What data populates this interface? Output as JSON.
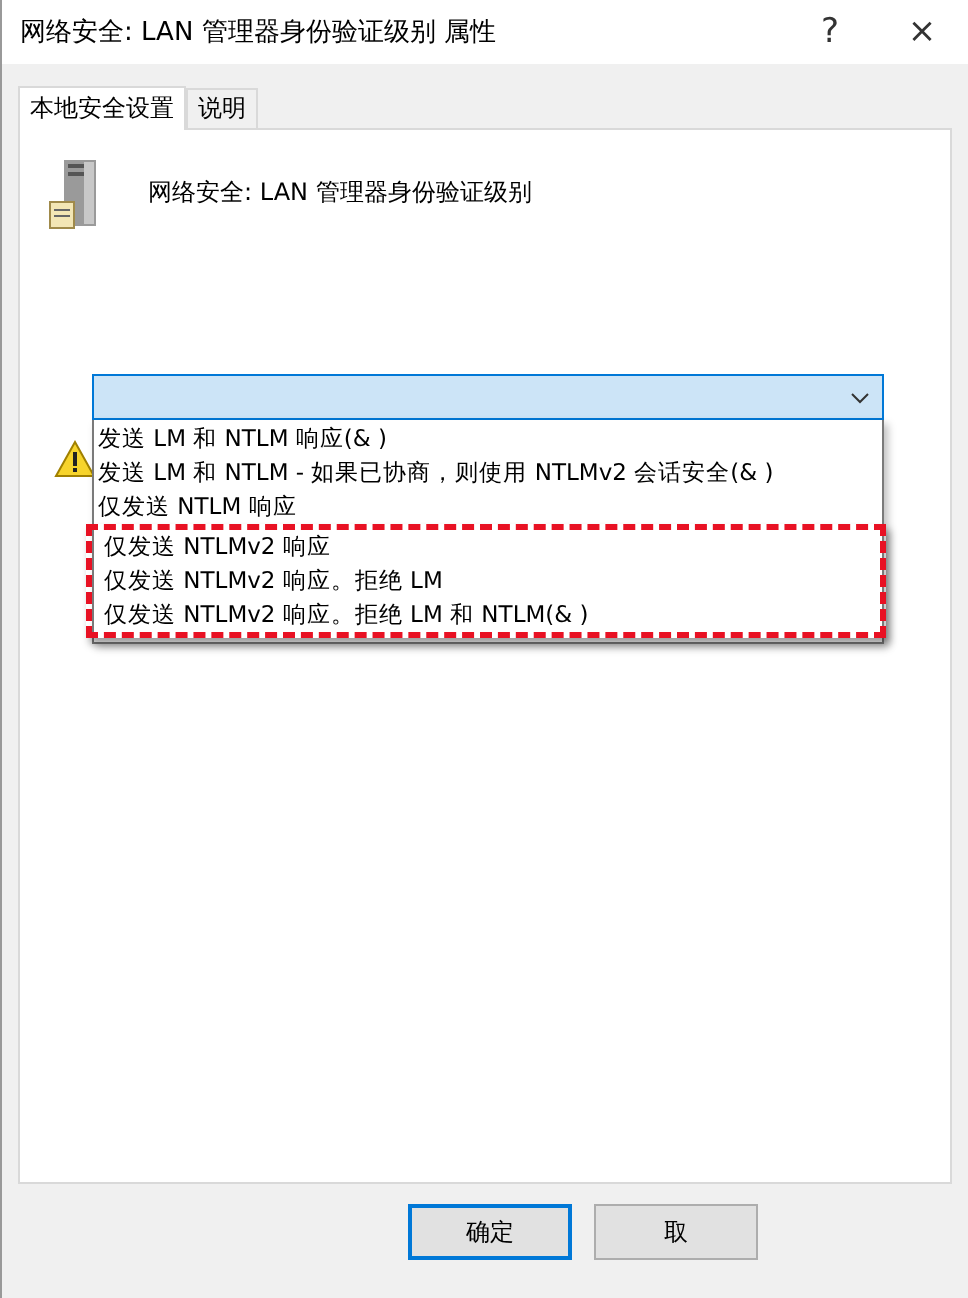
{
  "window": {
    "title": "网络安全: LAN 管理器身份验证级别 属性",
    "help": "?",
    "close": "×"
  },
  "tabs": [
    {
      "label": "本地安全设置",
      "selected": true
    },
    {
      "label": "说明",
      "selected": false
    }
  ],
  "heading": "网络安全: LAN 管理器身份验证级别",
  "dropdown": {
    "expanded": true,
    "options": [
      {
        "label": "发送 LM 和 NTLM 响应(& )",
        "highlighted": false
      },
      {
        "label": "发送 LM 和 NTLM - 如果已协商，则使用 NTLMv2 会话安全(& )",
        "highlighted": false
      },
      {
        "label": "仅发送 NTLM 响应",
        "highlighted": false
      },
      {
        "label": "仅发送 NTLMv2 响应",
        "highlighted": true
      },
      {
        "label": "仅发送 NTLMv2 响应。拒绝 LM",
        "highlighted": true
      },
      {
        "label": "仅发送 NTLMv2 响应。拒绝 LM 和 NTLM(& )",
        "highlighted": true
      }
    ]
  },
  "buttons": [
    {
      "label": "确定",
      "default": true
    },
    {
      "label": "取",
      "default": false
    }
  ]
}
